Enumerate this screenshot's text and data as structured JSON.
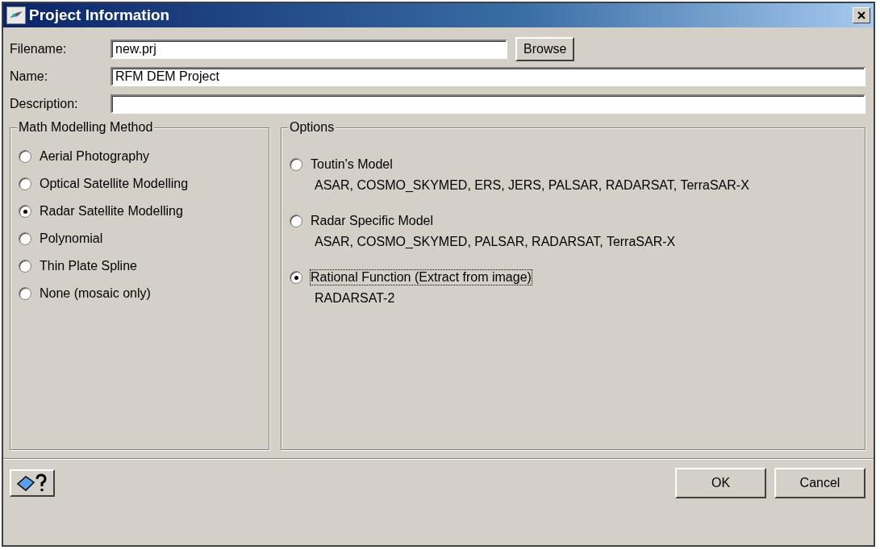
{
  "window": {
    "title": "Project Information"
  },
  "fields": [
    {
      "label": "Filename:",
      "value": "new.prj",
      "button": "Browse"
    },
    {
      "label": "Name:",
      "value": "RFM DEM Project"
    },
    {
      "label": "Description:"
    }
  ],
  "method_group": {
    "title": "Math Modelling Method",
    "options": [
      {
        "label": "Aerial Photography",
        "selected": false
      },
      {
        "label": "Optical Satellite Modelling",
        "selected": false
      },
      {
        "label": "Radar Satellite Modelling",
        "selected": true
      },
      {
        "label": "Polynomial",
        "selected": false
      },
      {
        "label": "Thin Plate Spline",
        "selected": false
      },
      {
        "label": "None (mosaic only)",
        "selected": false
      }
    ]
  },
  "options_group": {
    "title": "Options",
    "options": [
      {
        "label": "Toutin's Model",
        "description": "ASAR, COSMO_SKYMED, ERS, JERS, PALSAR, RADARSAT, TerraSAR-X",
        "selected": false
      },
      {
        "label": "Radar Specific Model",
        "description": "ASAR, COSMO_SKYMED, PALSAR, RADARSAT, TerraSAR-X",
        "selected": false
      },
      {
        "label": "Rational Function (Extract from image)",
        "description": "RADARSAT-2",
        "selected": true
      }
    ]
  },
  "buttons": [
    "OK",
    "Cancel"
  ]
}
